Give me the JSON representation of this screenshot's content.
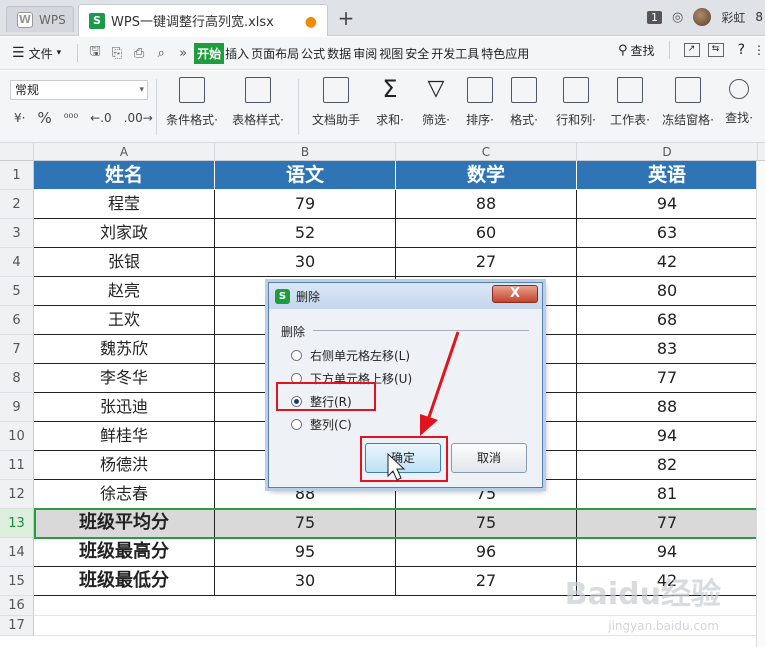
{
  "titlebar": {
    "app_tab": "WPS",
    "doc_tab": "WPS一键调整行高列宽.xlsx",
    "new_tab": "+",
    "window_count": "1",
    "username": "彩虹",
    "extra": "8"
  },
  "menubar": {
    "file": "文件",
    "tabs": [
      "开始",
      "插入",
      "页面布局",
      "公式",
      "数据",
      "审阅",
      "视图",
      "安全",
      "开发工具",
      "特色应用"
    ],
    "search": "查找",
    "help": "?"
  },
  "toolbar": {
    "number_format": "常规",
    "format_symbols": [
      "¥·",
      "%",
      "⁰⁰⁰",
      "←.0",
      ".00→"
    ],
    "tools": [
      "条件格式·",
      "表格样式·",
      "文档助手",
      "求和·",
      "筛选·",
      "排序·",
      "格式·",
      "行和列·",
      "工作表·",
      "冻结窗格·",
      "查找·"
    ]
  },
  "sheet": {
    "columns": [
      "A",
      "B",
      "C",
      "D"
    ],
    "row_numbers": [
      "1",
      "2",
      "3",
      "4",
      "5",
      "6",
      "7",
      "8",
      "9",
      "10",
      "11",
      "12",
      "13",
      "14",
      "15",
      "16",
      "17"
    ],
    "header": [
      "姓名",
      "语文",
      "数学",
      "英语"
    ],
    "rows": [
      [
        "程莹",
        "79",
        "88",
        "94"
      ],
      [
        "刘家政",
        "52",
        "60",
        "63"
      ],
      [
        "张银",
        "30",
        "27",
        "42"
      ],
      [
        "赵亮",
        "",
        "",
        "80"
      ],
      [
        "王欢",
        "",
        "",
        "68"
      ],
      [
        "魏苏欣",
        "",
        "",
        "83"
      ],
      [
        "李冬华",
        "",
        "",
        "77"
      ],
      [
        "张迅迪",
        "",
        "",
        "88"
      ],
      [
        "鲜桂华",
        "",
        "",
        "94"
      ],
      [
        "杨德洪",
        "",
        "",
        "82"
      ],
      [
        "徐志春",
        "88",
        "75",
        "81"
      ],
      [
        "班级平均分",
        "75",
        "75",
        "77"
      ],
      [
        "班级最高分",
        "95",
        "96",
        "94"
      ],
      [
        "班级最低分",
        "30",
        "27",
        "42"
      ]
    ]
  },
  "dialog": {
    "title": "删除",
    "close": "X",
    "group_label": "删除",
    "options": [
      "右侧单元格左移(L)",
      "下方单元格上移(U)",
      "整行(R)",
      "整列(C)"
    ],
    "selected_option": 2,
    "ok": "确定",
    "cancel": "取消"
  },
  "watermark": {
    "brand": "Baidu经验",
    "url": "jingyan.baidu.com"
  },
  "colors": {
    "header_blue": "#2f75b5",
    "accent_green": "#1e9d3f",
    "highlight_red": "#e0141e"
  }
}
